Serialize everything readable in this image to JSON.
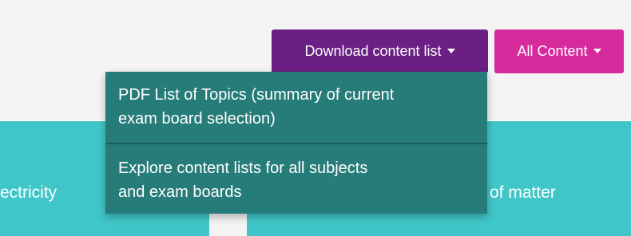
{
  "colors": {
    "download_button": "#6b1f84",
    "content_button": "#d72a9d",
    "dropdown_bg": "#267c79",
    "card_teal": "#40c6c8"
  },
  "toolbar": {
    "download_label": "Download content list",
    "content_label": "All Content"
  },
  "dropdown": {
    "items": [
      {
        "line1": "PDF List of Topics (summary of current",
        "line2": "exam board selection)"
      },
      {
        "line1": "Explore content lists for all subjects",
        "line2": "and exam boards"
      }
    ]
  },
  "cards": {
    "left_label": "ectricity",
    "right_label": "of matter"
  },
  "icons": {
    "download_caret": "chevron-down-icon",
    "content_caret": "chevron-down-icon"
  }
}
